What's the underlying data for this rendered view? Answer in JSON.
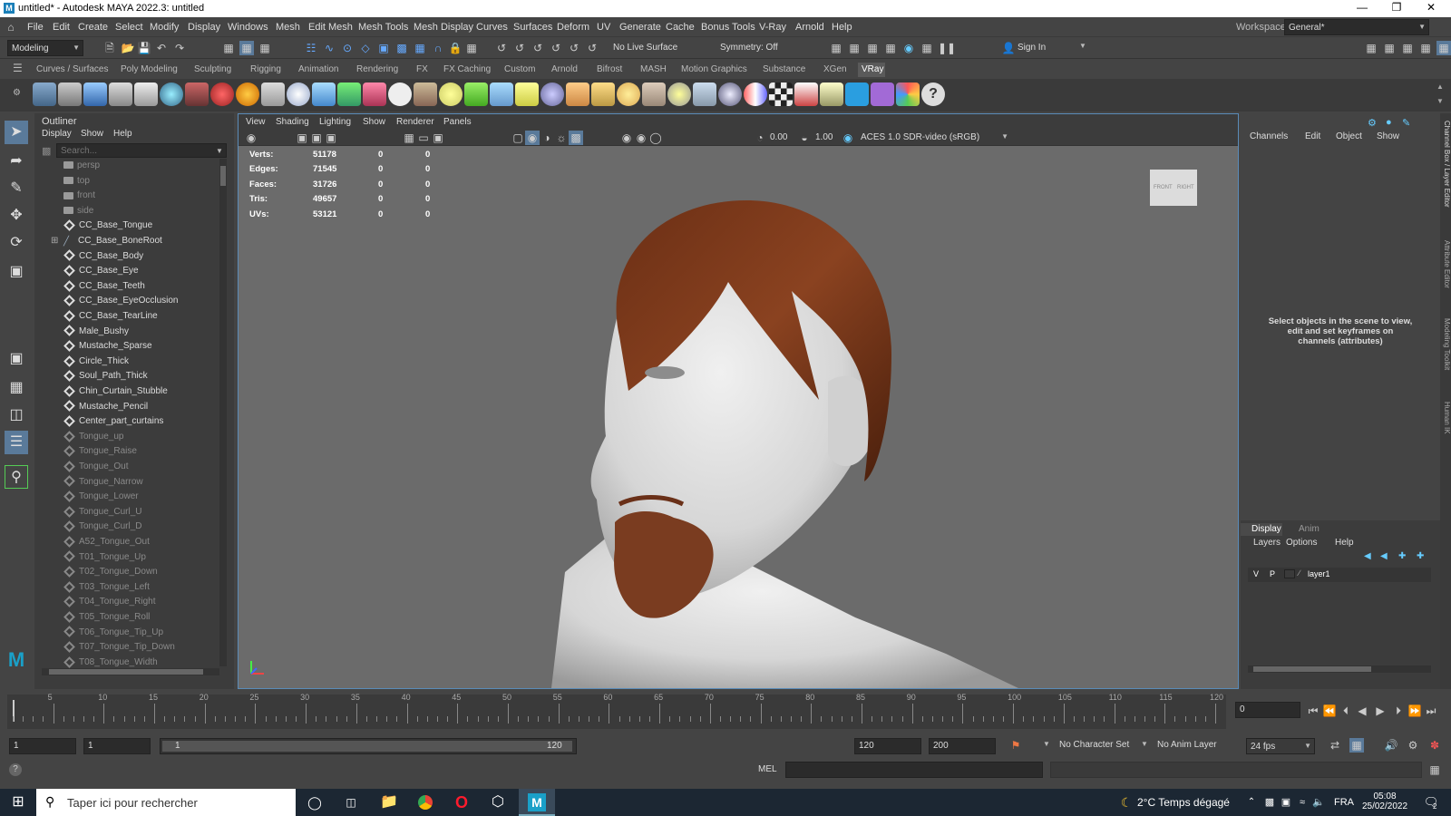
{
  "window": {
    "title": "untitled* - Autodesk MAYA 2022.3: untitled",
    "logo_letter": "M"
  },
  "menu": [
    "File",
    "Edit",
    "Create",
    "Select",
    "Modify",
    "Display",
    "Windows",
    "Mesh",
    "Edit Mesh",
    "Mesh Tools",
    "Mesh Display",
    "Curves",
    "Surfaces",
    "Deform",
    "UV",
    "Generate",
    "Cache",
    "Bonus Tools",
    "V-Ray",
    "Arnold",
    "Help"
  ],
  "workspace": {
    "label": "Workspace:",
    "value": "General*"
  },
  "status": {
    "mode": "Modeling",
    "live_surface": "No Live Surface",
    "symmetry": "Symmetry: Off",
    "sign_in": "Sign In"
  },
  "shelf_tabs": [
    "Curves / Surfaces",
    "Poly Modeling",
    "Sculpting",
    "Rigging",
    "Animation",
    "Rendering",
    "FX",
    "FX Caching",
    "Custom",
    "Arnold",
    "Bifrost",
    "MASH",
    "Motion Graphics",
    "Substance",
    "XGen",
    "VRay"
  ],
  "active_shelf": "VRay",
  "outliner": {
    "title": "Outliner",
    "menu": [
      "Display",
      "Show",
      "Help"
    ],
    "search_placeholder": "Search...",
    "items": [
      {
        "label": "persp",
        "icon": "camera-icon",
        "gray": true
      },
      {
        "label": "top",
        "icon": "camera-icon",
        "gray": true
      },
      {
        "label": "front",
        "icon": "camera-icon",
        "gray": true
      },
      {
        "label": "side",
        "icon": "camera-icon",
        "gray": true
      },
      {
        "label": "CC_Base_Tongue",
        "icon": "mesh-icon",
        "gray": false
      },
      {
        "label": "CC_Base_BoneRoot",
        "icon": "joint-icon",
        "gray": false,
        "expand": true
      },
      {
        "label": "CC_Base_Body",
        "icon": "mesh-icon",
        "gray": false
      },
      {
        "label": "CC_Base_Eye",
        "icon": "mesh-icon",
        "gray": false
      },
      {
        "label": "CC_Base_Teeth",
        "icon": "mesh-icon",
        "gray": false
      },
      {
        "label": "CC_Base_EyeOcclusion",
        "icon": "mesh-icon",
        "gray": false
      },
      {
        "label": "CC_Base_TearLine",
        "icon": "mesh-icon",
        "gray": false
      },
      {
        "label": "Male_Bushy",
        "icon": "mesh-icon",
        "gray": false
      },
      {
        "label": "Mustache_Sparse",
        "icon": "mesh-icon",
        "gray": false
      },
      {
        "label": "Circle_Thick",
        "icon": "mesh-icon",
        "gray": false
      },
      {
        "label": "Soul_Path_Thick",
        "icon": "mesh-icon",
        "gray": false
      },
      {
        "label": "Chin_Curtain_Stubble",
        "icon": "mesh-icon",
        "gray": false
      },
      {
        "label": "Mustache_Pencil",
        "icon": "mesh-icon",
        "gray": false
      },
      {
        "label": "Center_part_curtains",
        "icon": "mesh-icon",
        "gray": false
      },
      {
        "label": "Tongue_up",
        "icon": "mesh-icon",
        "gray": true
      },
      {
        "label": "Tongue_Raise",
        "icon": "mesh-icon",
        "gray": true
      },
      {
        "label": "Tongue_Out",
        "icon": "mesh-icon",
        "gray": true
      },
      {
        "label": "Tongue_Narrow",
        "icon": "mesh-icon",
        "gray": true
      },
      {
        "label": "Tongue_Lower",
        "icon": "mesh-icon",
        "gray": true
      },
      {
        "label": "Tongue_Curl_U",
        "icon": "mesh-icon",
        "gray": true
      },
      {
        "label": "Tongue_Curl_D",
        "icon": "mesh-icon",
        "gray": true
      },
      {
        "label": "A52_Tongue_Out",
        "icon": "mesh-icon",
        "gray": true
      },
      {
        "label": "T01_Tongue_Up",
        "icon": "mesh-icon",
        "gray": true
      },
      {
        "label": "T02_Tongue_Down",
        "icon": "mesh-icon",
        "gray": true
      },
      {
        "label": "T03_Tongue_Left",
        "icon": "mesh-icon",
        "gray": true
      },
      {
        "label": "T04_Tongue_Right",
        "icon": "mesh-icon",
        "gray": true
      },
      {
        "label": "T05_Tongue_Roll",
        "icon": "mesh-icon",
        "gray": true
      },
      {
        "label": "T06_Tongue_Tip_Up",
        "icon": "mesh-icon",
        "gray": true
      },
      {
        "label": "T07_Tongue_Tip_Down",
        "icon": "mesh-icon",
        "gray": true
      },
      {
        "label": "T08_Tongue_Width",
        "icon": "mesh-icon",
        "gray": true
      }
    ]
  },
  "viewport": {
    "menu": [
      "View",
      "Shading",
      "Lighting",
      "Show",
      "Renderer",
      "Panels"
    ],
    "exposure": "0.00",
    "gamma": "1.00",
    "color_space": "ACES 1.0 SDR-video (sRGB)",
    "hud": [
      {
        "label": "Verts:",
        "a": "51178",
        "b": "0",
        "c": "0"
      },
      {
        "label": "Edges:",
        "a": "71545",
        "b": "0",
        "c": "0"
      },
      {
        "label": "Faces:",
        "a": "31726",
        "b": "0",
        "c": "0"
      },
      {
        "label": "Tris:",
        "a": "49657",
        "b": "0",
        "c": "0"
      },
      {
        "label": "UVs:",
        "a": "53121",
        "b": "0",
        "c": "0"
      }
    ],
    "viewcube": {
      "front": "FRONT",
      "right": "RIGHT"
    }
  },
  "channel_box": {
    "menu": [
      "Channels",
      "Edit",
      "Object",
      "Show"
    ],
    "message": "Select objects in the scene to view, edit and set keyframes on channels (attributes)"
  },
  "layer_editor": {
    "tabs": [
      "Display",
      "Anim"
    ],
    "menu": [
      "Layers",
      "Options",
      "Help"
    ],
    "layer": {
      "v": "V",
      "p": "P",
      "name": "layer1"
    }
  },
  "side_tabs": [
    "Channel Box / Layer Editor",
    "Attribute Editor",
    "Modeling Toolkit",
    "Human IK"
  ],
  "timeline": {
    "ticks": [
      "5",
      "10",
      "15",
      "20",
      "25",
      "30",
      "35",
      "40",
      "45",
      "50",
      "55",
      "60",
      "65",
      "70",
      "75",
      "80",
      "85",
      "90",
      "95",
      "100",
      "105",
      "110",
      "115",
      "120"
    ],
    "current_frame": "0"
  },
  "range": {
    "start": "1",
    "anim_start": "1",
    "range_start": "1",
    "range_end": "120",
    "end": "120",
    "anim_end": "200",
    "character_set": "No Character Set",
    "anim_layer": "No Anim Layer",
    "fps": "24 fps"
  },
  "command_line": {
    "lang": "MEL"
  },
  "taskbar": {
    "search_placeholder": "Taper ici pour rechercher",
    "weather": "2°C  Temps dégagé",
    "lang": "FRA",
    "time": "05:08",
    "date": "25/02/2022",
    "notifications": "2"
  },
  "colors": {
    "accent": "#5a8bb8",
    "hair": "#7a3a1c",
    "beard": "#8a4a2a",
    "maya_logo": "#1aa0c8"
  }
}
